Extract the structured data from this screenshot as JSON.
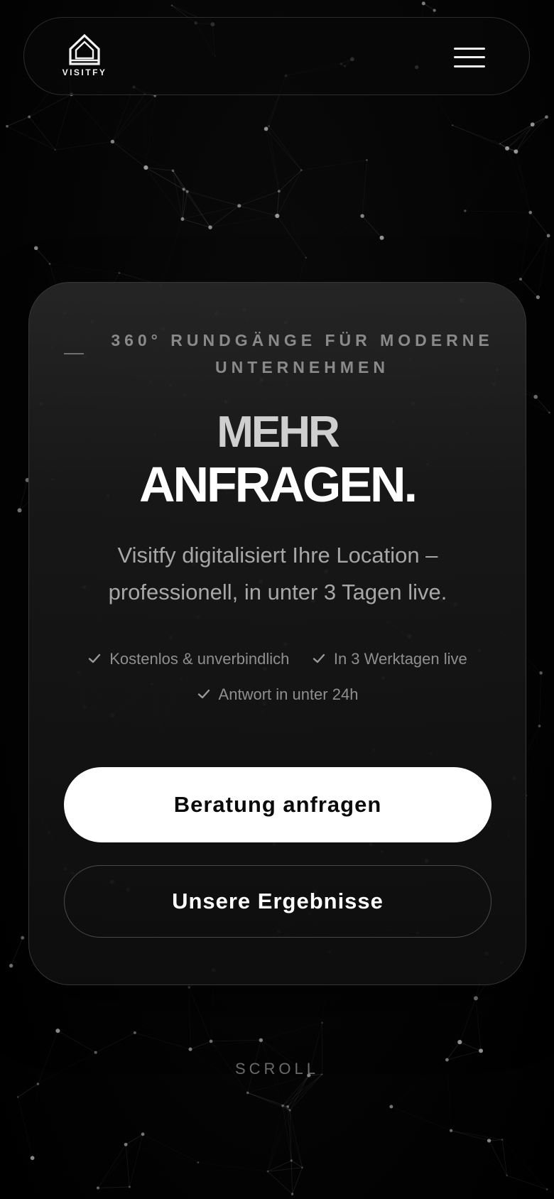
{
  "header": {
    "logo_text": "VISITFY"
  },
  "hero": {
    "eyebrow": "360° RUNDGÄNGE FÜR MODERNE UNTERNEHMEN",
    "headline_line1": "MEHR",
    "headline_line2": "ANFRAGEN.",
    "subtitle": "Visitfy digitalisiert Ihre Location – professionell, in unter 3 Tagen live.",
    "features": [
      {
        "label": "Kostenlos & unverbindlich",
        "icon": "check-icon"
      },
      {
        "label": "In 3 Werktagen live",
        "icon": "check-icon"
      },
      {
        "label": "Antwort in unter 24h",
        "icon": "check-icon"
      }
    ],
    "primary_button": "Beratung anfragen",
    "secondary_button": "Unsere Ergebnisse"
  },
  "scroll_hint": "SCROLL",
  "colors": {
    "background": "#030303",
    "card": "#181818",
    "primary_button_bg": "#ffffff",
    "text_muted": "#8f8f8f"
  }
}
